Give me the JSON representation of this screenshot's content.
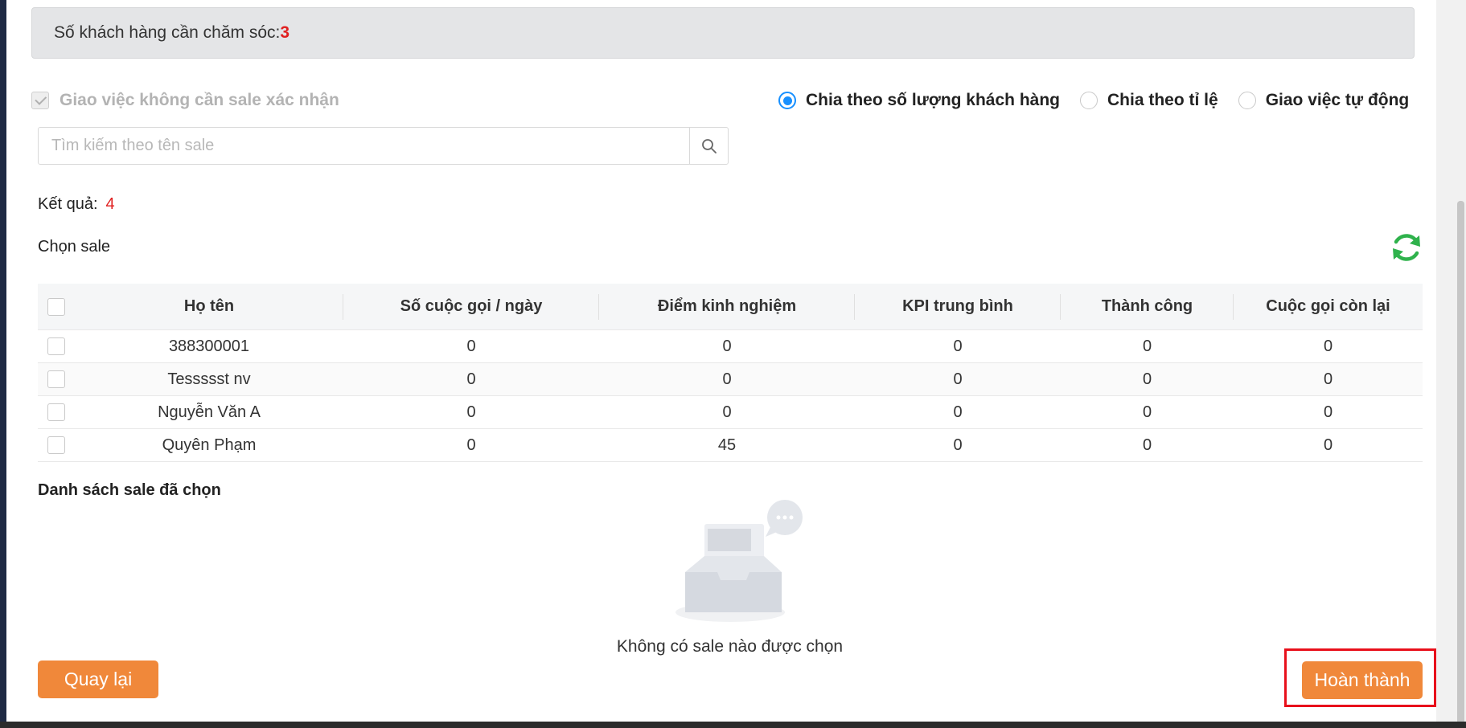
{
  "info_bar": {
    "label": "Số khách hàng cần chăm sóc:",
    "count": "3"
  },
  "confirm_option": {
    "label": "Giao việc không cần sale xác nhận",
    "checked": true,
    "disabled": true
  },
  "distribution": {
    "options": [
      {
        "label": "Chia theo số lượng khách hàng",
        "selected": true
      },
      {
        "label": "Chia theo tỉ lệ",
        "selected": false
      },
      {
        "label": "Giao việc tự động",
        "selected": false
      }
    ]
  },
  "search": {
    "placeholder": "Tìm kiếm theo tên sale",
    "value": ""
  },
  "result": {
    "label": "Kết quả:",
    "count": "4"
  },
  "choose_label": "Chọn sale",
  "table": {
    "headers": [
      "Họ tên",
      "Số cuộc gọi / ngày",
      "Điểm kinh nghiệm",
      "KPI trung bình",
      "Thành công",
      "Cuộc gọi còn lại"
    ],
    "rows": [
      [
        "388300001",
        "0",
        "0",
        "0",
        "0",
        "0"
      ],
      [
        "Tessssst nv",
        "0",
        "0",
        "0",
        "0",
        "0"
      ],
      [
        "Nguyễn Văn A",
        "0",
        "0",
        "0",
        "0",
        "0"
      ],
      [
        "Quyên Phạm",
        "0",
        "45",
        "0",
        "0",
        "0"
      ]
    ]
  },
  "selected_section": {
    "title": "Danh sách sale đã chọn",
    "empty_text": "Không có sale nào được chọn"
  },
  "buttons": {
    "back": "Quay lại",
    "done": "Hoàn thành"
  },
  "colors": {
    "accent": "#f0883a",
    "radio": "#1890ff",
    "count": "#e02020",
    "refresh": "#2fb24c",
    "highlight": "#e8101b"
  }
}
